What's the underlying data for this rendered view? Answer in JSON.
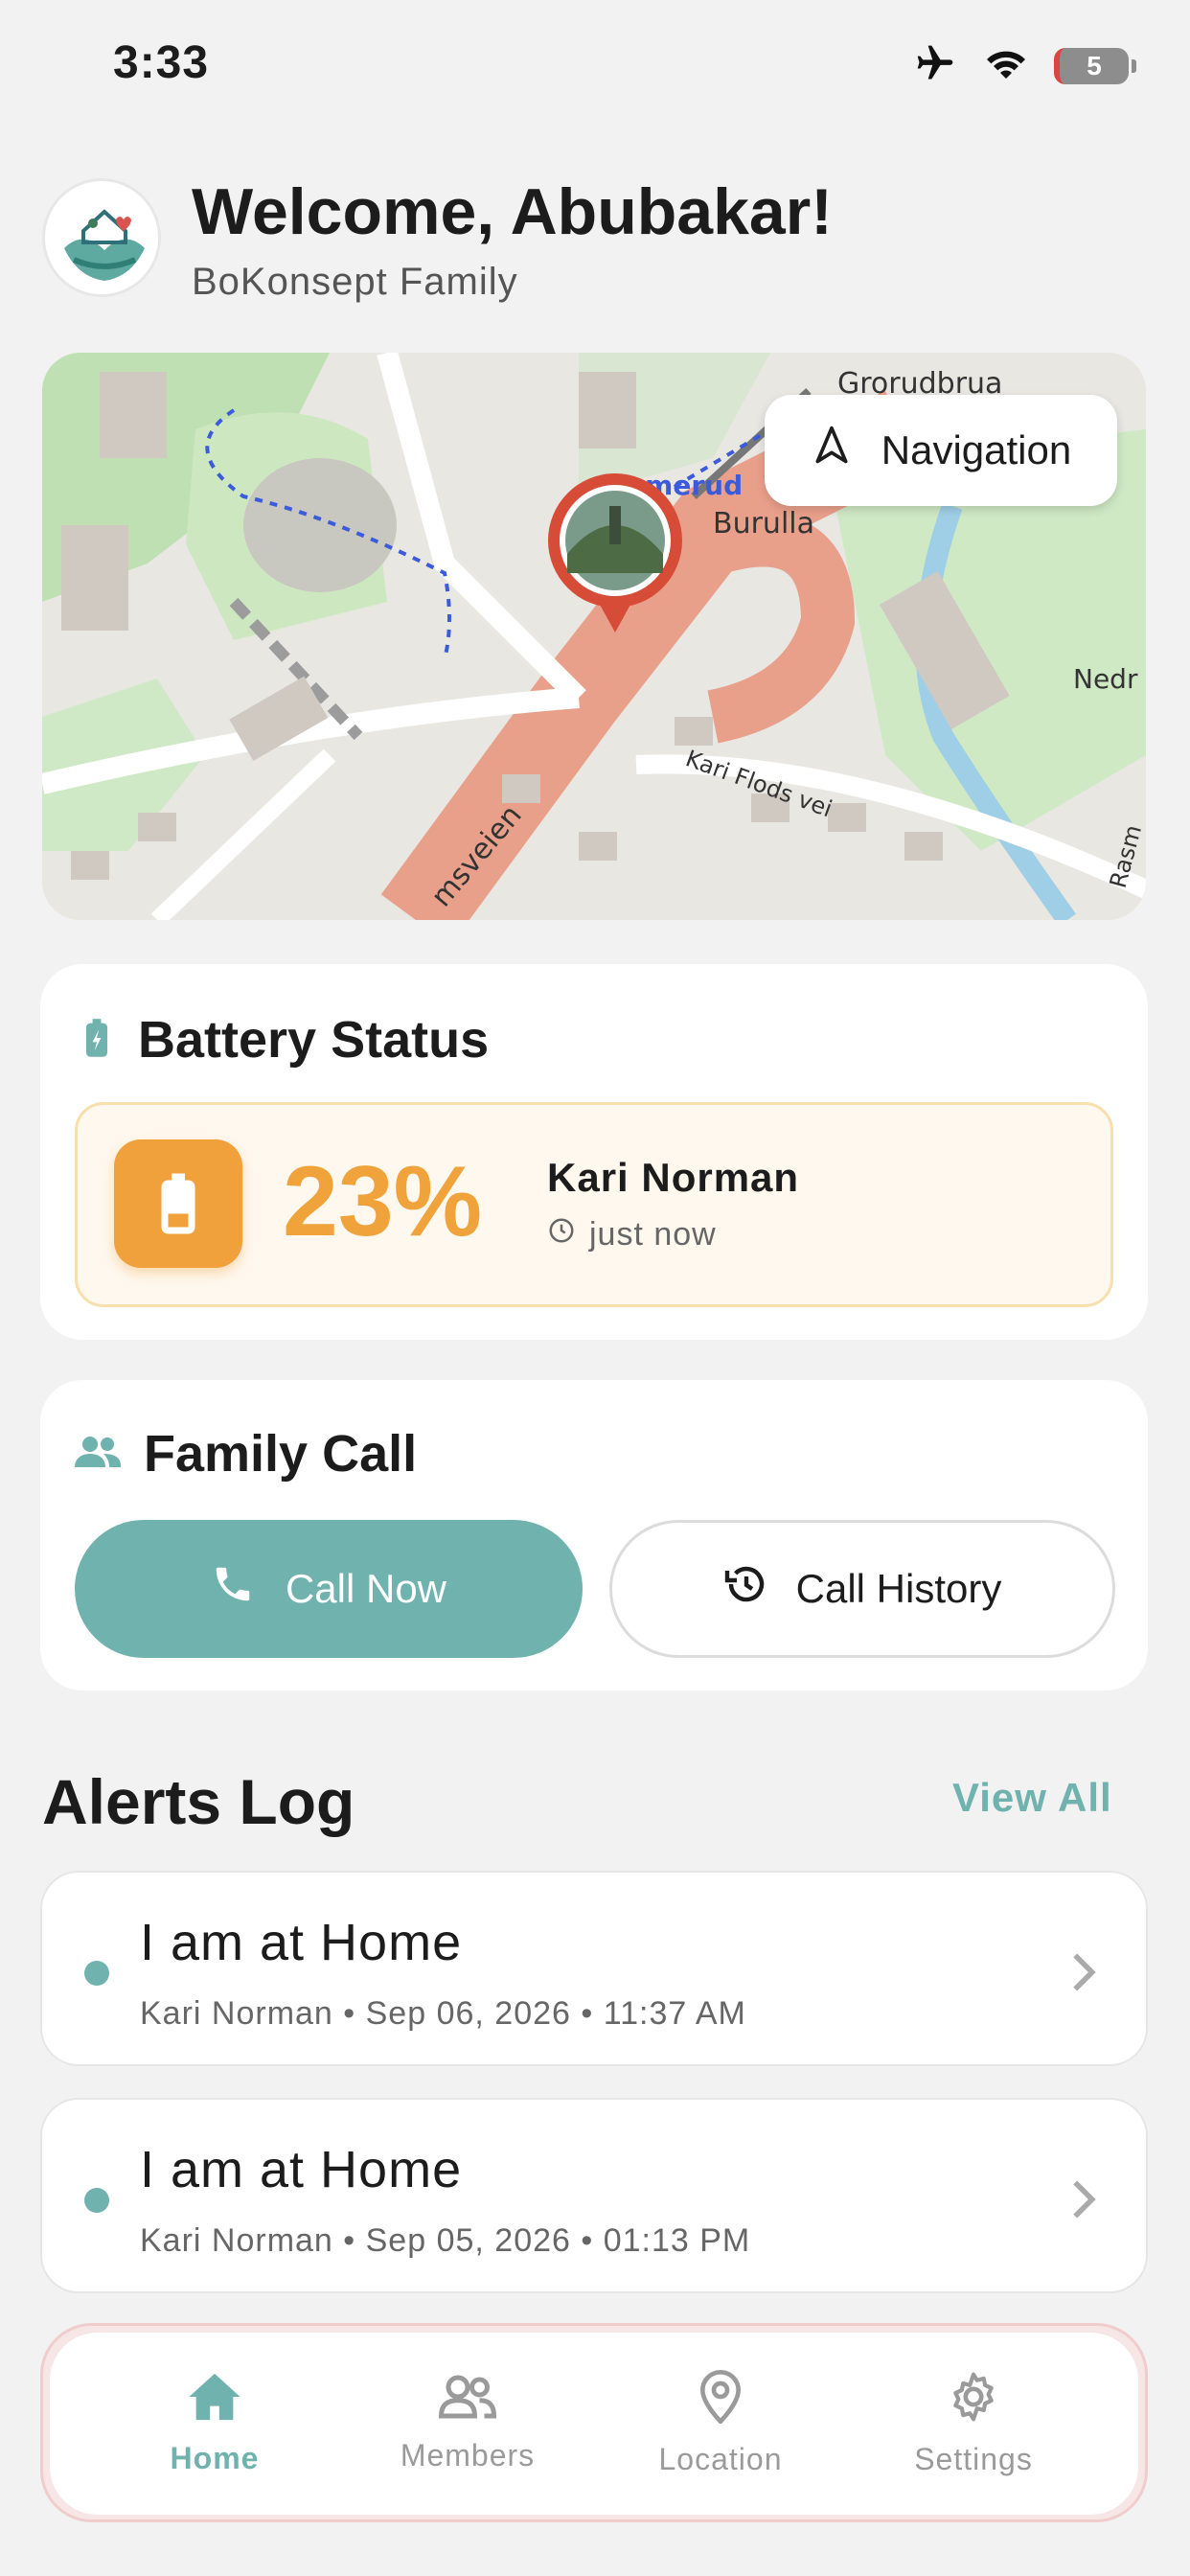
{
  "status_bar": {
    "time": "3:33",
    "battery_level": "5",
    "icons": [
      "airplane-icon",
      "wifi-icon",
      "battery-icon"
    ]
  },
  "header": {
    "welcome": "Welcome, Abubakar!",
    "family_name": "BoKonsept Family"
  },
  "map": {
    "navigation_label": "Navigation",
    "labels": [
      "Grorudbrua",
      "mmerud",
      "Burulla",
      "Nedr",
      "Kari Flods vei",
      "msveien",
      "Rasm"
    ]
  },
  "battery": {
    "title": "Battery Status",
    "percent": "23%",
    "member": "Kari Norman",
    "updated": "just now"
  },
  "family_call": {
    "title": "Family Call",
    "call_now": "Call Now",
    "call_history": "Call History"
  },
  "alerts": {
    "title": "Alerts Log",
    "view_all": "View All",
    "items": [
      {
        "title": "I am at Home",
        "meta": "Kari Norman • Sep 06, 2026 • 11:37 AM"
      },
      {
        "title": "I am at Home",
        "meta": "Kari Norman • Sep 05, 2026 • 01:13 PM"
      }
    ]
  },
  "tabs": [
    {
      "label": "Home",
      "icon": "home-icon",
      "active": true
    },
    {
      "label": "Members",
      "icon": "members-icon",
      "active": false
    },
    {
      "label": "Location",
      "icon": "location-pin-icon",
      "active": false
    },
    {
      "label": "Settings",
      "icon": "gear-icon",
      "active": false
    }
  ],
  "colors": {
    "accent": "#6fb2ae",
    "battery_orange": "#f1a13b",
    "background": "#f1f2f1"
  }
}
